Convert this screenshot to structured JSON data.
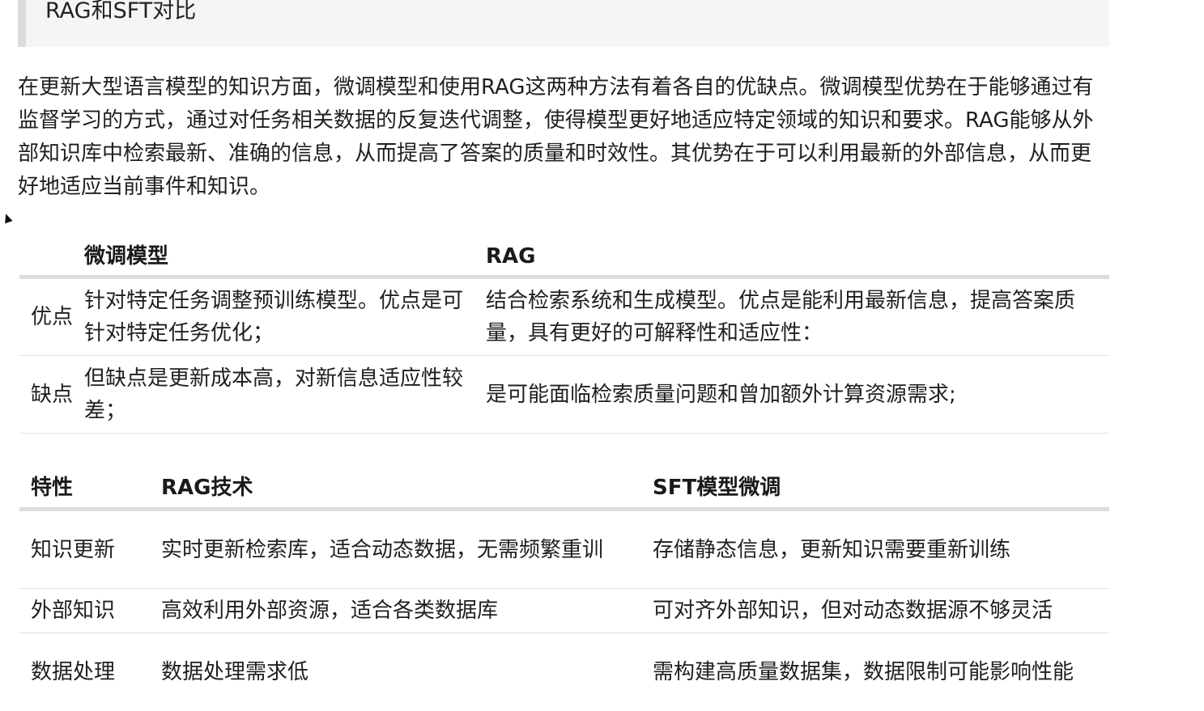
{
  "heading": "RAG和SFT对比",
  "intro": "在更新大型语言模型的知识方面，微调模型和使用RAG这两种方法有着各自的优缺点。微调模型优势在于能够通过有监督学习的方式，通过对任务相关数据的反复迭代调整，使得模型更好地适应特定领域的知识和要求。RAG能够从外部知识库中检索最新、准确的信息，从而提高了答案的质量和时效性。其优势在于可以利用最新的外部信息，从而更好地适应当前事件和知识。",
  "table1": {
    "headers": [
      "",
      "微调模型",
      "RAG"
    ],
    "rows": [
      [
        "优点",
        "针对特定任务调整预训练模型。优点是可针对特定任务优化；",
        "结合检索系统和生成模型。优点是能利用最新信息，提高答案质量，具有更好的可解释性和适应性："
      ],
      [
        "缺点",
        "但缺点是更新成本高，对新信息适应性较差；",
        "是可能面临检索质量问题和曾加额外计算资源需求;"
      ]
    ]
  },
  "table2": {
    "headers": [
      "特性",
      "RAG技术",
      "SFT模型微调"
    ],
    "rows": [
      [
        "知识更新",
        "实时更新检索库，适合动态数据，无需频繁重训",
        "存储静态信息，更新知识需要重新训练"
      ],
      [
        "外部知识",
        "高效利用外部资源，适合各类数据库",
        "可对齐外部知识，但对动态数据源不够灵活"
      ],
      [
        "数据处理",
        "数据处理需求低",
        "需构建高质量数据集，数据限制可能影响性能"
      ]
    ]
  }
}
